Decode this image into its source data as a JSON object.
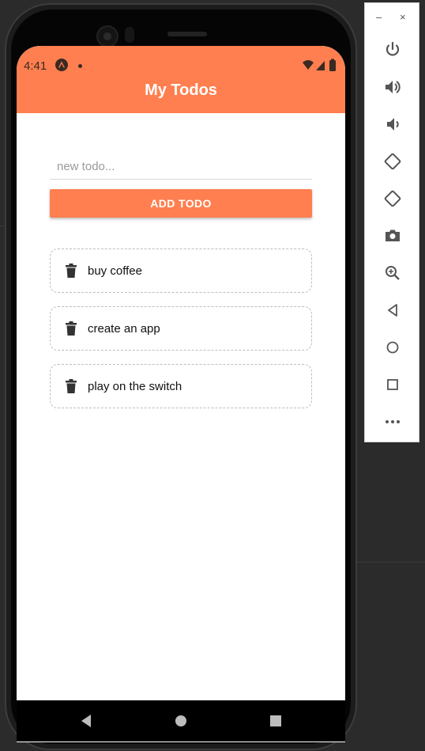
{
  "status_bar": {
    "time": "4:41"
  },
  "app": {
    "title": "My Todos",
    "input": {
      "value": "",
      "placeholder": "new todo..."
    },
    "add_button_label": "ADD TODO",
    "todos": [
      {
        "text": "buy coffee"
      },
      {
        "text": "create an app"
      },
      {
        "text": "play on the switch"
      }
    ]
  },
  "emulator_panel": {
    "window_controls": {
      "minimize": "–",
      "close": "×"
    },
    "buttons": [
      "power-icon",
      "volume-up-icon",
      "volume-down-icon",
      "rotate-left-icon",
      "rotate-right-icon",
      "camera-icon",
      "zoom-icon",
      "back-icon",
      "home-icon",
      "overview-icon",
      "more-icon"
    ]
  },
  "colors": {
    "accent": "#ff7f50",
    "screen_bg": "#ffffff",
    "frame": "#1c1c1c",
    "background": "#2b2b2b"
  }
}
